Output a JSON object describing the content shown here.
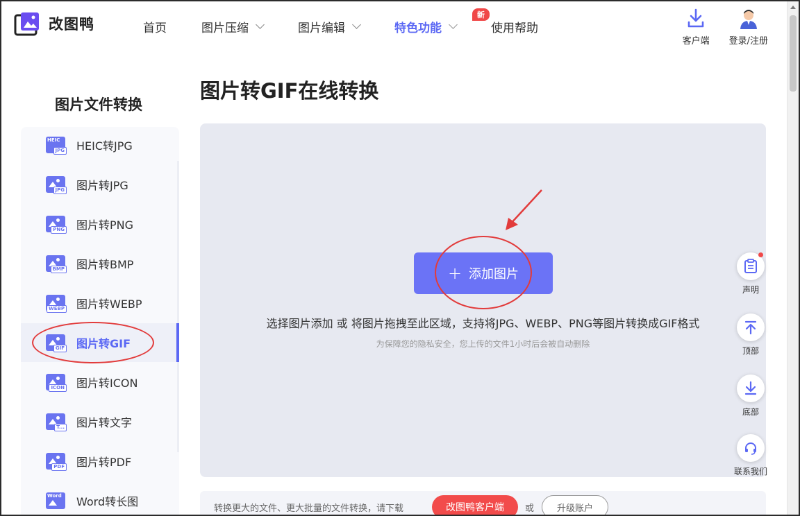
{
  "brand": {
    "name": "改图鸭"
  },
  "nav": {
    "items": [
      {
        "label": "首页",
        "has_dropdown": false
      },
      {
        "label": "图片压缩",
        "has_dropdown": true
      },
      {
        "label": "图片编辑",
        "has_dropdown": true
      },
      {
        "label": "特色功能",
        "has_dropdown": true,
        "active": true,
        "badge": "新"
      },
      {
        "label": "使用帮助",
        "has_dropdown": false
      }
    ]
  },
  "header_actions": {
    "client": {
      "label": "客户端",
      "icon": "download-icon"
    },
    "login": {
      "label": "登录/注册",
      "icon": "user-avatar-icon"
    }
  },
  "sidebar": {
    "title": "图片文件转换",
    "items": [
      {
        "label": "HEIC转JPG",
        "tag": "JPG",
        "top_tag": "HEIC"
      },
      {
        "label": "图片转JPG",
        "tag": "JPG"
      },
      {
        "label": "图片转PNG",
        "tag": "PNG"
      },
      {
        "label": "图片转BMP",
        "tag": "BMP"
      },
      {
        "label": "图片转WEBP",
        "tag": "WEBP"
      },
      {
        "label": "图片转GIF",
        "tag": "GIF",
        "active": true
      },
      {
        "label": "图片转ICON",
        "tag": "ICON"
      },
      {
        "label": "图片转文字",
        "tag": "T..."
      },
      {
        "label": "图片转PDF",
        "tag": "PDF"
      },
      {
        "label": "Word转长图",
        "tag": "Word"
      }
    ]
  },
  "main": {
    "title": "图片转GIF在线转换",
    "upload": {
      "button_label": "添加图片",
      "description": "选择图片添加 或 将图片拖拽至此区域，支持将JPG、WEBP、PNG等图片转换成GIF格式",
      "privacy_note": "为保障您的隐私安全，您上传的文件1小时后会被自动删除"
    },
    "promo": {
      "text": "转换更大的文件、更大批量的文件转换，请下载",
      "client_button": "改图鸭客户端",
      "or": "或",
      "upgrade_button": "升级账户"
    }
  },
  "float_bar": {
    "statement": "声明",
    "top": "顶部",
    "bottom": "底部",
    "contact": "联系我们"
  },
  "colors": {
    "accent": "#5b68f4",
    "button": "#6b73f6",
    "annotation_red": "#e23b3b",
    "promo_red": "#f24b4b"
  }
}
